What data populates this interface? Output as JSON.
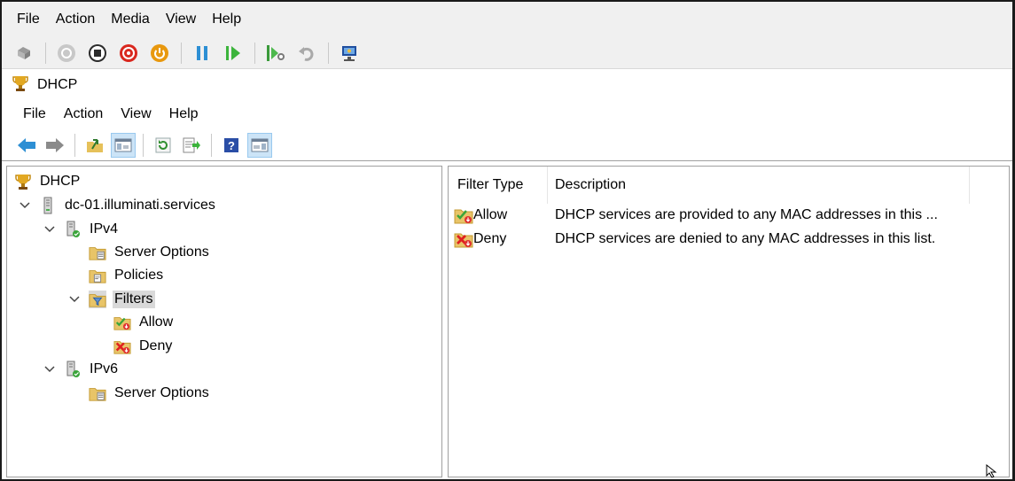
{
  "vm_menu": [
    "File",
    "Action",
    "Media",
    "View",
    "Help"
  ],
  "vm_toolbar": [
    "ctrl-alt-del-icon",
    "start-icon",
    "turn-off-icon",
    "shutdown-icon",
    "save-state-icon",
    "pause-icon",
    "resume-icon",
    "checkpoint-icon",
    "revert-icon",
    "enhanced-session-icon"
  ],
  "mmc": {
    "title": "DHCP",
    "menu": [
      "File",
      "Action",
      "View",
      "Help"
    ]
  },
  "tree": {
    "root": "DHCP",
    "server": "dc-01.illuminati.services",
    "ipv4": "IPv4",
    "ipv4_server_options": "Server Options",
    "policies": "Policies",
    "filters": "Filters",
    "allow": "Allow",
    "deny": "Deny",
    "ipv6": "IPv6",
    "ipv6_server_options": "Server Options"
  },
  "list": {
    "columns": [
      "Filter Type",
      "Description"
    ],
    "rows": [
      {
        "type": "Allow",
        "description": "DHCP services are provided to any MAC addresses in this ..."
      },
      {
        "type": "Deny",
        "description": "DHCP services are denied to any MAC addresses in this list."
      }
    ]
  }
}
